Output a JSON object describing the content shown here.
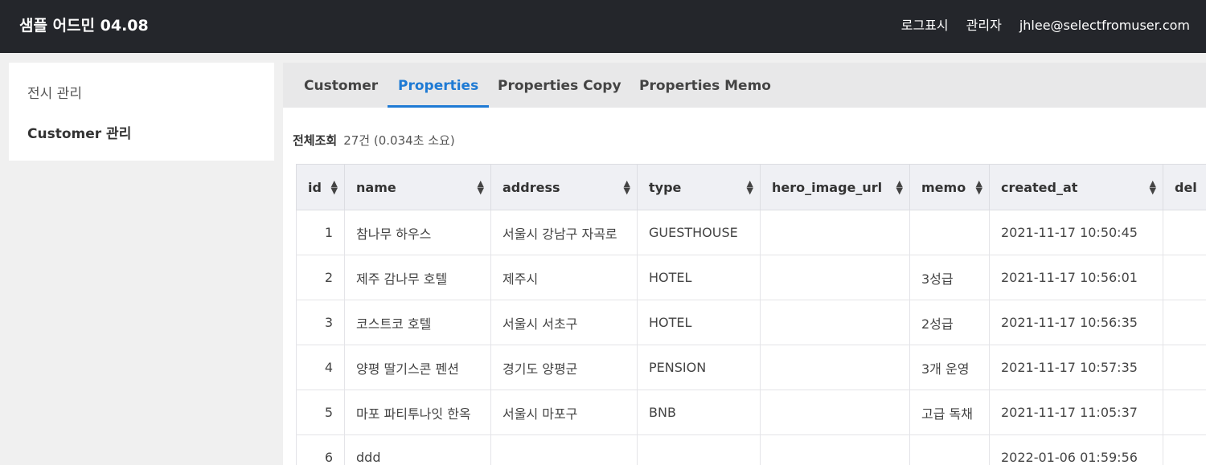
{
  "header": {
    "title": "샘플 어드민 04.08",
    "nav": [
      "로그표시",
      "관리자",
      "jhlee@selectfromuser.com"
    ]
  },
  "sidebar": {
    "items": [
      {
        "label": "전시 관리"
      },
      {
        "label": "Customer 관리"
      }
    ]
  },
  "tabs": [
    {
      "label": "Customer"
    },
    {
      "label": "Properties"
    },
    {
      "label": "Properties Copy"
    },
    {
      "label": "Properties Memo"
    }
  ],
  "active_tab": "Properties",
  "summary": {
    "label": "전체조회",
    "text": "27건 (0.034초 소요)"
  },
  "table": {
    "columns": [
      "id",
      "name",
      "address",
      "type",
      "hero_image_url",
      "memo",
      "created_at",
      "del"
    ],
    "rows": [
      [
        "1",
        "참나무 하우스",
        "서울시 강남구 자곡로",
        "GUESTHOUSE",
        "",
        "",
        "2021-11-17 10:50:45",
        ""
      ],
      [
        "2",
        "제주 감나무 호텔",
        "제주시",
        "HOTEL",
        "",
        "3성급",
        "2021-11-17 10:56:01",
        ""
      ],
      [
        "3",
        "코스트코 호텔",
        "서울시 서초구",
        "HOTEL",
        "",
        "2성급",
        "2021-11-17 10:56:35",
        ""
      ],
      [
        "4",
        "양평 딸기스콘 펜션",
        "경기도 양평군",
        "PENSION",
        "",
        "3개 운영",
        "2021-11-17 10:57:35",
        ""
      ],
      [
        "5",
        "마포 파티투나잇 한옥",
        "서울시 마포구",
        "BNB",
        "",
        "고급 독채",
        "2021-11-17 11:05:37",
        ""
      ],
      [
        "6",
        "ddd",
        "",
        "",
        "",
        "",
        "2022-01-06 01:59:56",
        ""
      ]
    ]
  }
}
